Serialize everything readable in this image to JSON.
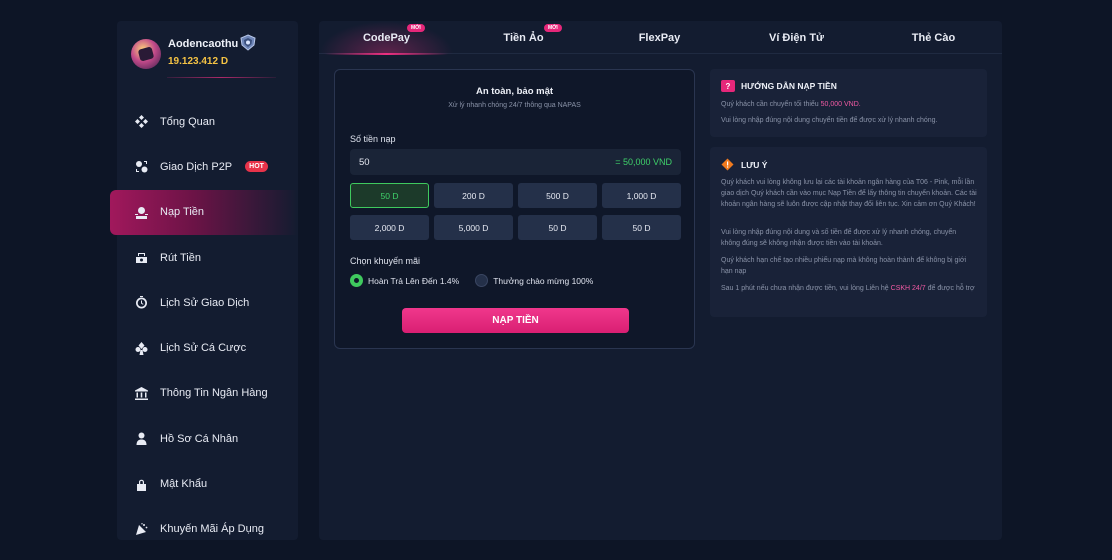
{
  "user": {
    "name": "Aodencaothu",
    "balance": "19.123.412 D"
  },
  "sidebar": {
    "items": [
      {
        "label": "Tổng Quan",
        "icon": "diamonds-icon"
      },
      {
        "label": "Giao Dịch P2P",
        "icon": "p2p-icon",
        "badge": "HOT"
      },
      {
        "label": "Nạp Tiền",
        "icon": "deposit-icon",
        "active": true
      },
      {
        "label": "Rút Tiền",
        "icon": "withdraw-icon"
      },
      {
        "label": "Lịch Sử Giao Dịch",
        "icon": "history-icon"
      },
      {
        "label": "Lịch Sử Cá Cược",
        "icon": "bet-history-icon"
      },
      {
        "label": "Thông Tin Ngân Hàng",
        "icon": "bank-icon"
      },
      {
        "label": "Hồ Sơ Cá Nhân",
        "icon": "user-icon"
      },
      {
        "label": "Mật Khẩu",
        "icon": "lock-icon"
      },
      {
        "label": "Khuyến Mãi Áp Dụng",
        "icon": "promo-icon"
      }
    ]
  },
  "tabs": [
    {
      "label": "CodePay",
      "badge": "MỚI",
      "active": true
    },
    {
      "label": "Tiền Ảo",
      "badge": "MỚI"
    },
    {
      "label": "FlexPay"
    },
    {
      "label": "Ví Điện Tử"
    },
    {
      "label": "Thẻ Cào"
    }
  ],
  "deposit": {
    "title": "An toàn, bảo mật",
    "subtitle": "Xử lý nhanh chóng 24/7 thông qua NAPAS",
    "amount_label": "Số tiền nạp",
    "amount_value": "50",
    "amount_converted": "= 50,000 VND",
    "chips": [
      "50 D",
      "200 D",
      "500 D",
      "1,000 D",
      "2,000 D",
      "5,000 D",
      "50 D",
      "50 D"
    ],
    "selected_chip": 0,
    "promo_label": "Chọn khuyến mãi",
    "promo_options": [
      "Hoàn Trả Lên Đến 1.4%",
      "Thưởng chào mừng 100%"
    ],
    "promo_selected": 0,
    "submit_label": "NẠP TIỀN"
  },
  "guide": {
    "title": "HƯỚNG DẪN NẠP TIỀN",
    "line1_prefix": "Quý khách cần chuyển tối thiểu ",
    "line1_amount": "50,000 VND.",
    "line2": "Vui lòng nhập đúng nội dung chuyển tiền để được xử lý nhanh chóng."
  },
  "notes": {
    "title": "LƯU Ý",
    "p1": "Quý khách vui lòng không lưu lại các tài khoản ngân hàng của T06 - Pink, mỗi lần giao dịch Quý khách cần vào mục Nạp Tiền để lấy thông tin chuyển khoản. Các tài khoản ngân hàng sẽ luôn được cập nhật thay đổi liên tục. Xin cảm ơn Quý Khách!",
    "p2": "Vui lòng nhập đúng nội dung và số tiền để được xử lý nhanh chóng, chuyển không đúng sẽ không nhận được tiền vào tài khoản.",
    "p3": "Quý khách hạn chế tạo nhiều phiếu nạp mà không hoàn thành để không bị giới hạn nạp",
    "p4_prefix": "Sau 1 phút nếu chưa nhận được tiền, vui lòng Liên hệ ",
    "p4_link": "CSKH 24/7",
    "p4_suffix": " để được hỗ trợ"
  },
  "colors": {
    "accent": "#ec2f80",
    "gold": "#f5c344",
    "green": "#3fd16a",
    "bg": "#0d1526",
    "panel": "#131c30"
  }
}
